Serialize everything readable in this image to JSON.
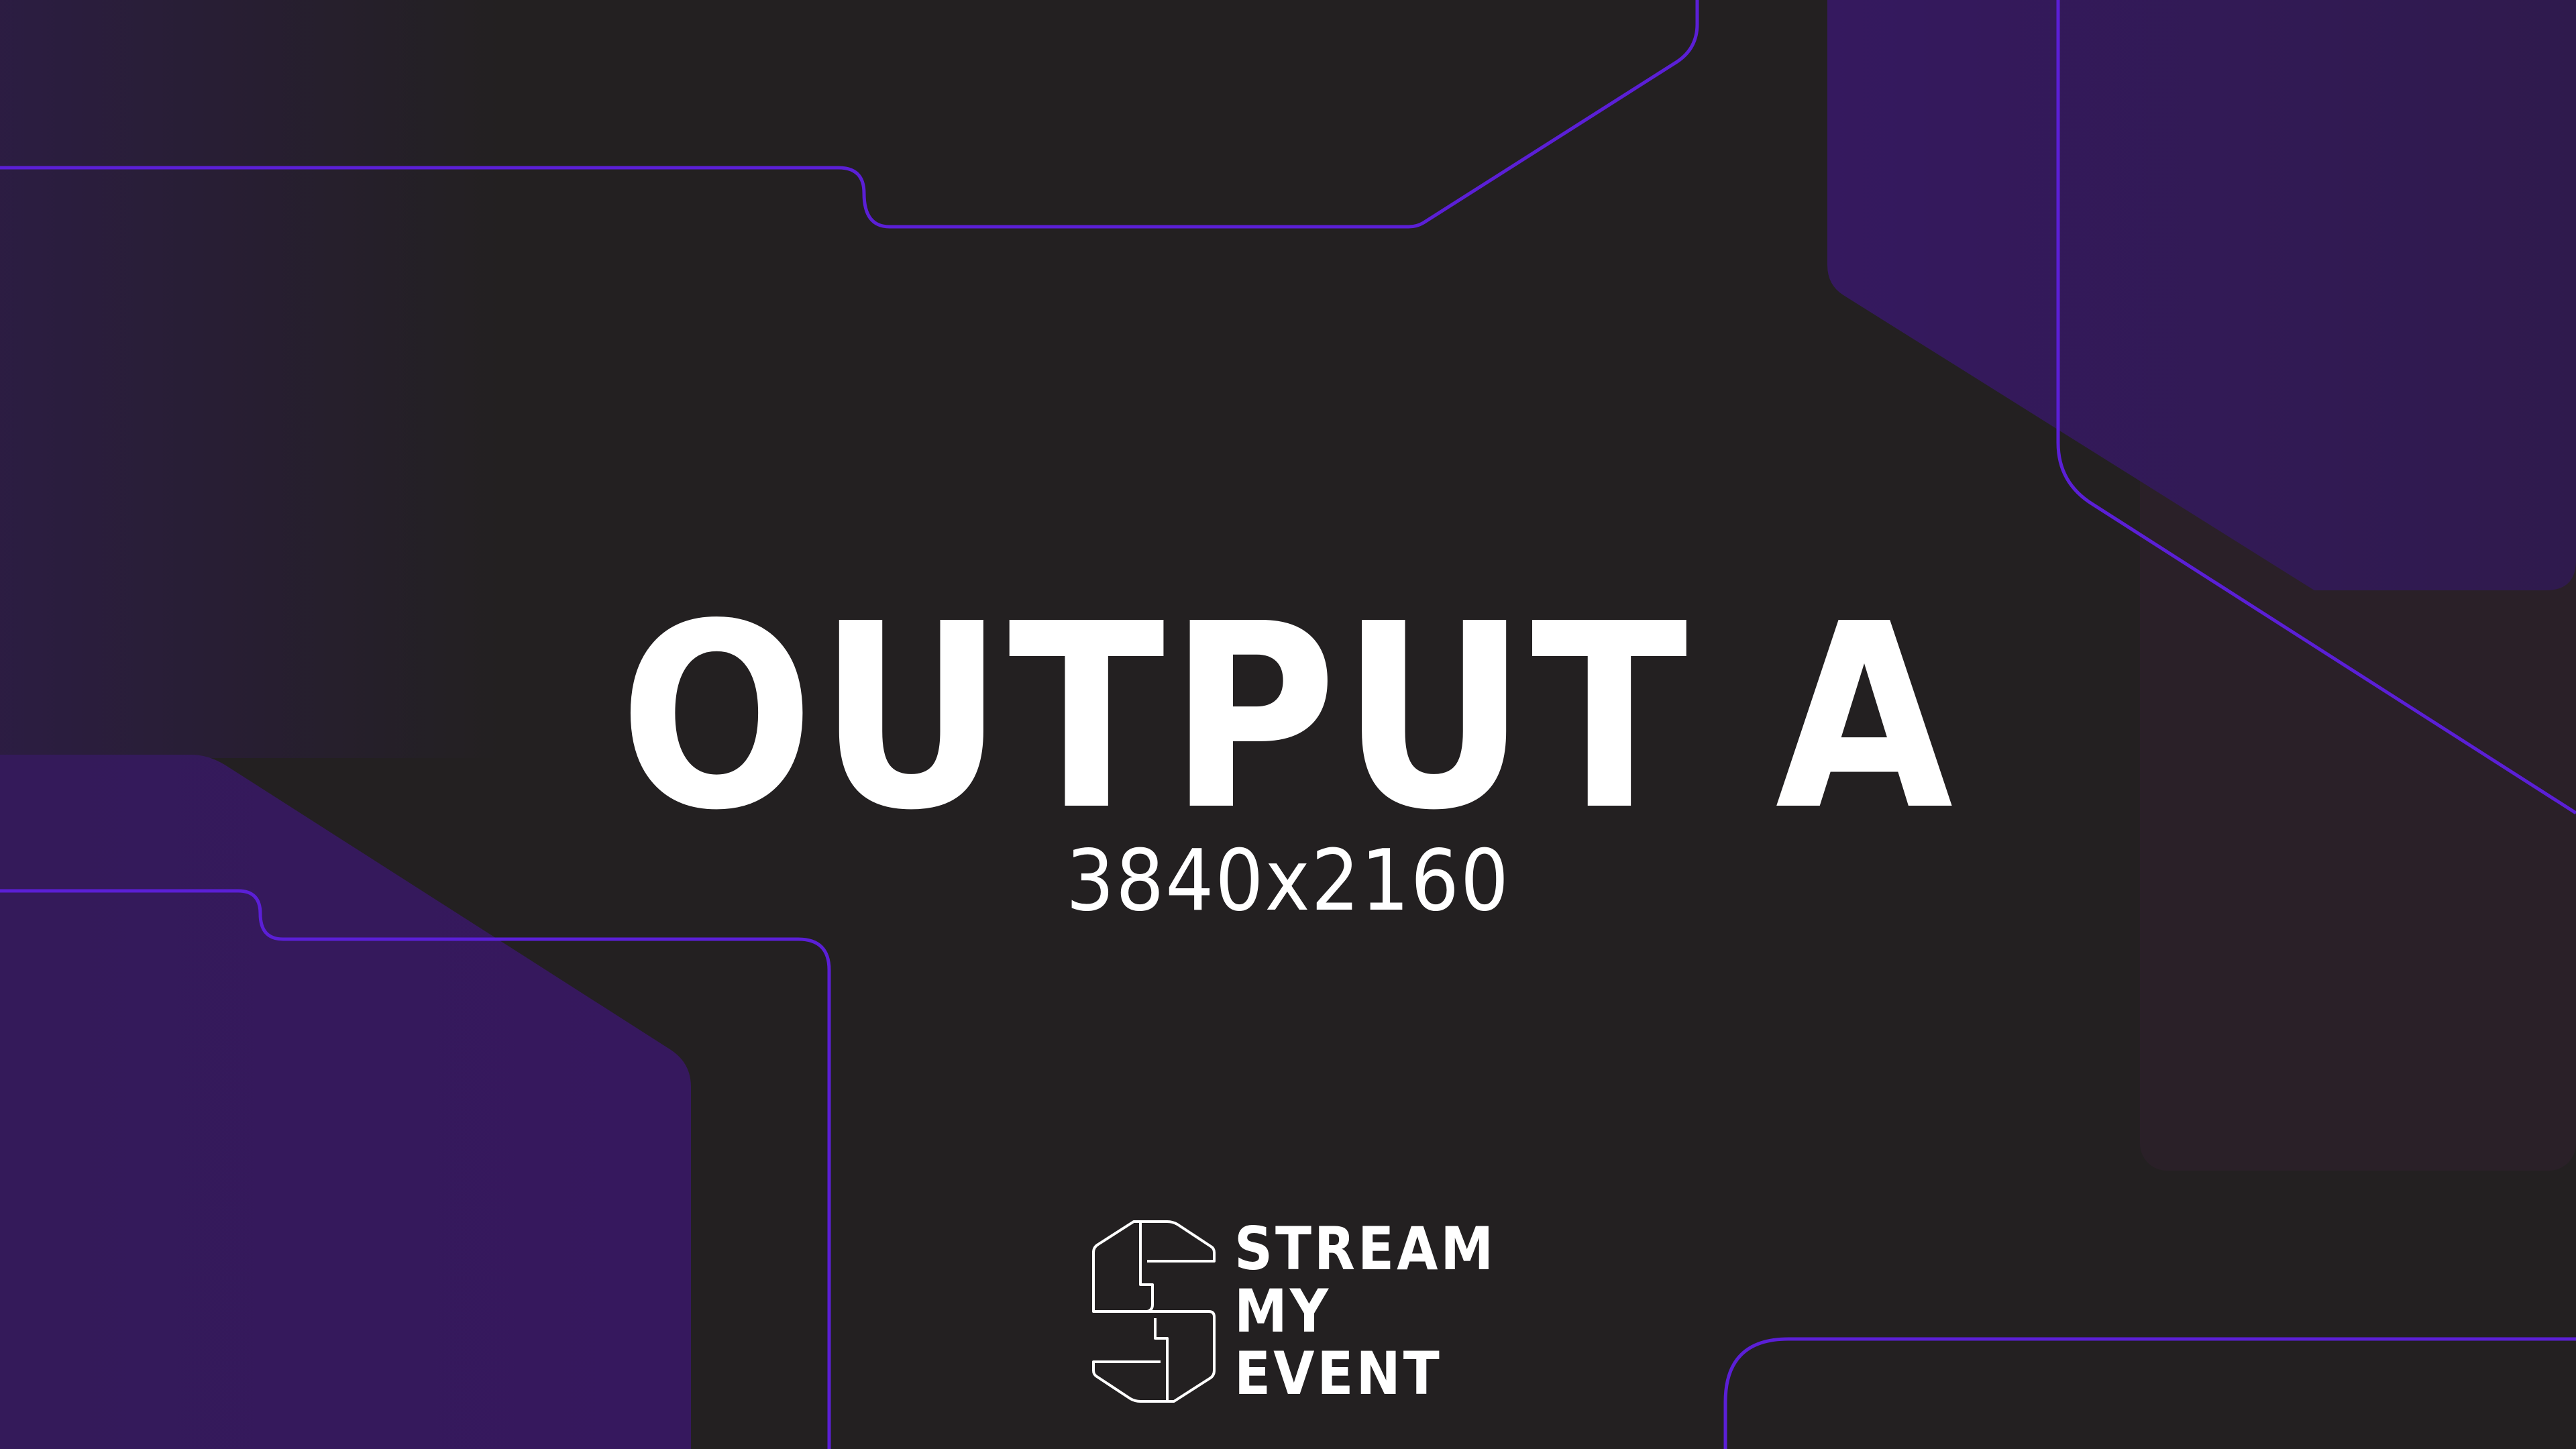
{
  "screen": {
    "title": "OUTPUT A",
    "resolution": "3840x2160"
  },
  "brand": {
    "line1": "STREAM",
    "line2": "MY",
    "line3": "EVENT"
  },
  "colors": {
    "background": "#232021",
    "accent_line": "#5b1fd6",
    "panel_purple": "#331a5c",
    "text": "#ffffff"
  }
}
